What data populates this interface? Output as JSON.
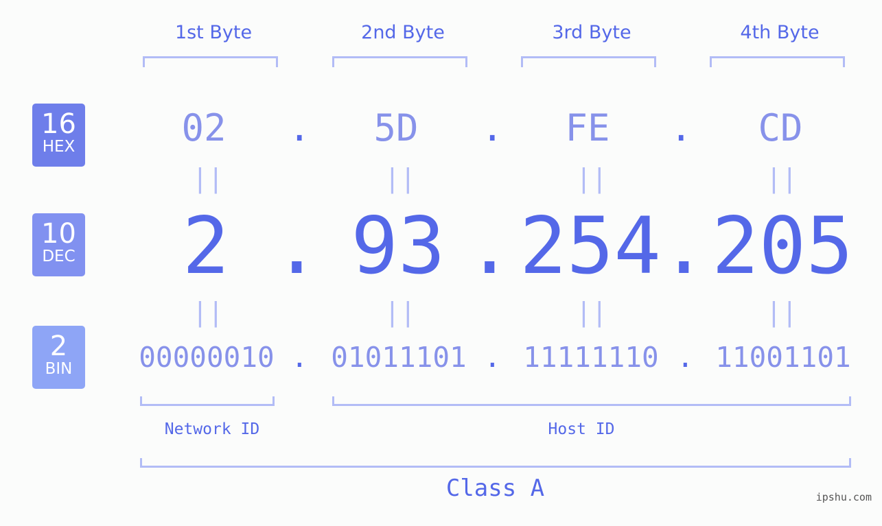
{
  "byte_headers": [
    "1st Byte",
    "2nd Byte",
    "3rd Byte",
    "4th Byte"
  ],
  "badges": {
    "hex": {
      "num": "16",
      "label": "HEX",
      "color": "#6e7eea"
    },
    "dec": {
      "num": "10",
      "label": "DEC",
      "color": "#8191f0"
    },
    "bin": {
      "num": "2",
      "label": "BIN",
      "color": "#8ea5f6"
    }
  },
  "separator": ".",
  "equals": "||",
  "hex_values": [
    "02",
    "5D",
    "FE",
    "CD"
  ],
  "dec_values": [
    "2",
    "93",
    "254",
    "205"
  ],
  "bin_values": [
    "00000010",
    "01011101",
    "11111110",
    "11001101"
  ],
  "network_id_label": "Network ID",
  "host_id_label": "Host ID",
  "class_label": "Class A",
  "watermark": "ipshu.com"
}
